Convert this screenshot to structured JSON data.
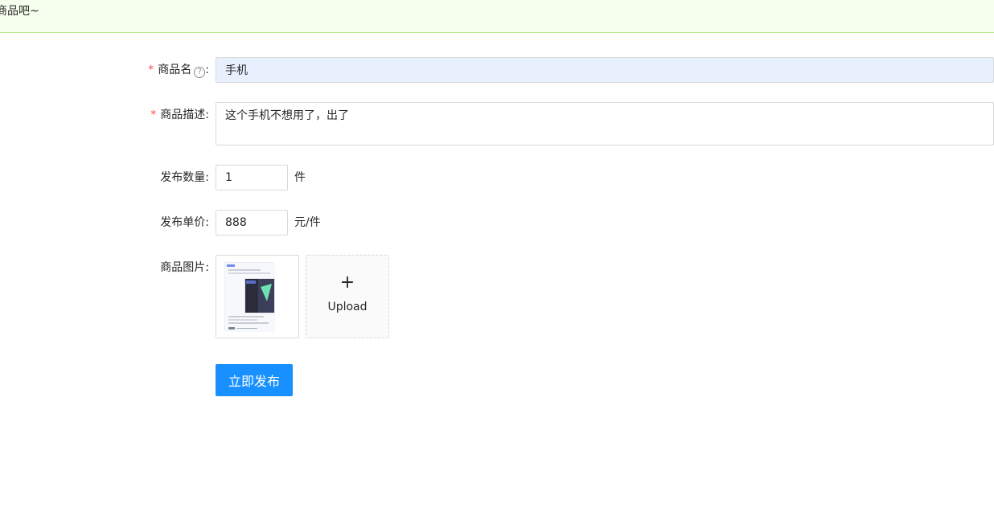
{
  "banner": {
    "text": "商品吧~"
  },
  "form": {
    "name": {
      "label": "商品名",
      "colon": ":",
      "required_mark": "*",
      "value": "手机"
    },
    "description": {
      "label": "商品描述:",
      "required_mark": "*",
      "value": "这个手机不想用了，出了"
    },
    "quantity": {
      "label": "发布数量:",
      "value": "1",
      "suffix": "件"
    },
    "price": {
      "label": "发布单价:",
      "value": "888",
      "suffix": "元/件"
    },
    "images": {
      "label": "商品图片:",
      "upload_plus": "+",
      "upload_label": "Upload"
    },
    "submit_label": "立即发布"
  },
  "colors": {
    "primary": "#1890ff",
    "banner_bg": "#f6ffed",
    "banner_border": "#b7eb8f",
    "required": "#ff4d4f"
  }
}
